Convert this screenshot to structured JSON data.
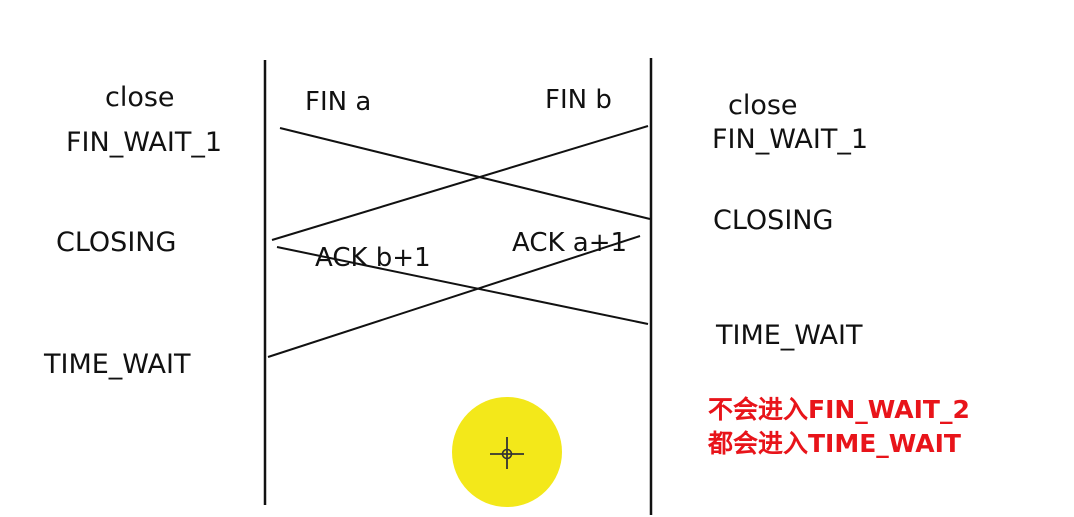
{
  "left_states": [
    "close",
    "FIN_WAIT_1",
    "CLOSING",
    "TIME_WAIT"
  ],
  "right_states": [
    "close",
    "FIN_WAIT_1",
    "CLOSING",
    "TIME_WAIT"
  ],
  "messages": {
    "fin_a": "FIN a",
    "fin_b": "FIN b",
    "ack_b": "ACK b+1",
    "ack_a": "ACK a+1"
  },
  "note": [
    "不会进入FIN_WAIT_2",
    "都会进入TIME_WAIT"
  ],
  "colors": {
    "note": "#e8141a",
    "cursor": "#f3e81a",
    "line": "#111111"
  },
  "icons": {
    "cursor": "crosshair-cursor-icon"
  }
}
